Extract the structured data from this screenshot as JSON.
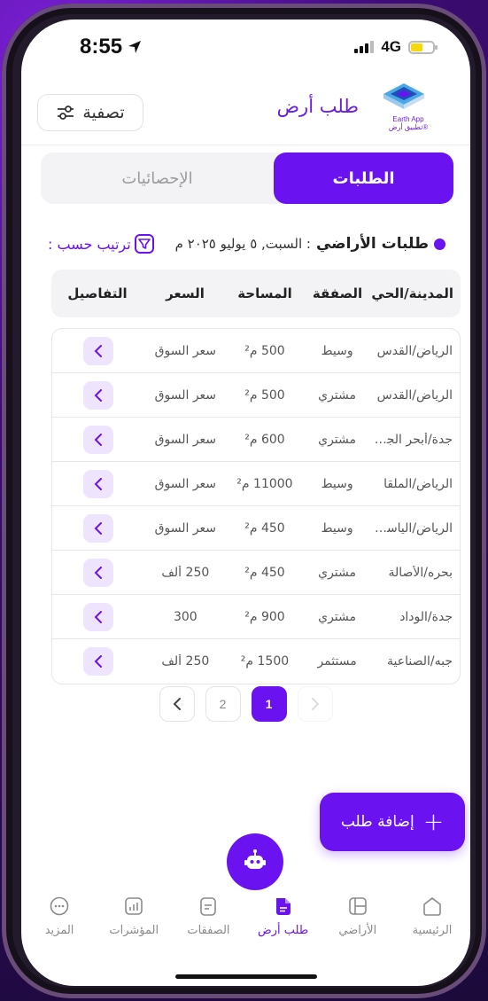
{
  "status_bar": {
    "time": "8:55",
    "network": "4G"
  },
  "header": {
    "title": "طلب أرض",
    "logo_line1": "Earth App",
    "logo_line2": "تطبيق أرض®",
    "filter_label": "تصفية"
  },
  "tabs": {
    "active": "الطلبات",
    "inactive": "الإحصائيات"
  },
  "info": {
    "label": "طلبات الأراضي",
    "date": ": السبت, ٥ يوليو ٢٠٢٥ م",
    "sort_label": "ترتيب حسب :"
  },
  "table": {
    "headers": [
      "المدينة/الحي",
      "الصفقة",
      "المساحة",
      "السعر",
      "التفاصيل"
    ],
    "rows": [
      {
        "city": "الرياض/القدس",
        "deal": "وسيط",
        "area": "500 م²",
        "price": "سعر السوق"
      },
      {
        "city": "الرياض/القدس",
        "deal": "مشتري",
        "area": "500 م²",
        "price": "سعر السوق"
      },
      {
        "city": "جدة/أبحر الجنوبية",
        "deal": "مشتري",
        "area": "600 م²",
        "price": "سعر السوق"
      },
      {
        "city": "الرياض/الملقا",
        "deal": "وسيط",
        "area": "11000 م²",
        "price": "سعر السوق"
      },
      {
        "city": "الرياض/الياسمين",
        "deal": "وسيط",
        "area": "450 م²",
        "price": "سعر السوق"
      },
      {
        "city": "بحره/الأصالة",
        "deal": "مشتري",
        "area": "450 م²",
        "price": "250 ألف"
      },
      {
        "city": "جدة/الوداد",
        "deal": "مشتري",
        "area": "900 م²",
        "price": "300"
      },
      {
        "city": "جبه/الصناعية",
        "deal": "مستثمر",
        "area": "1500 م²",
        "price": "250 ألف"
      }
    ]
  },
  "pagination": {
    "pages": [
      "1",
      "2"
    ],
    "current": "1"
  },
  "add_button_label": "إضافة طلب",
  "tabbar": [
    {
      "label": "الرئيسية",
      "icon": "home-icon"
    },
    {
      "label": "الأراضي",
      "icon": "map-grid-icon"
    },
    {
      "label": "طلب أرض",
      "icon": "document-icon"
    },
    {
      "label": "الصفقات",
      "icon": "deals-icon"
    },
    {
      "label": "المؤشرات",
      "icon": "chart-icon"
    },
    {
      "label": "المزيد",
      "icon": "more-icon"
    }
  ],
  "colors": {
    "accent": "#6a13f0",
    "accent_light": "#eee4fd"
  }
}
